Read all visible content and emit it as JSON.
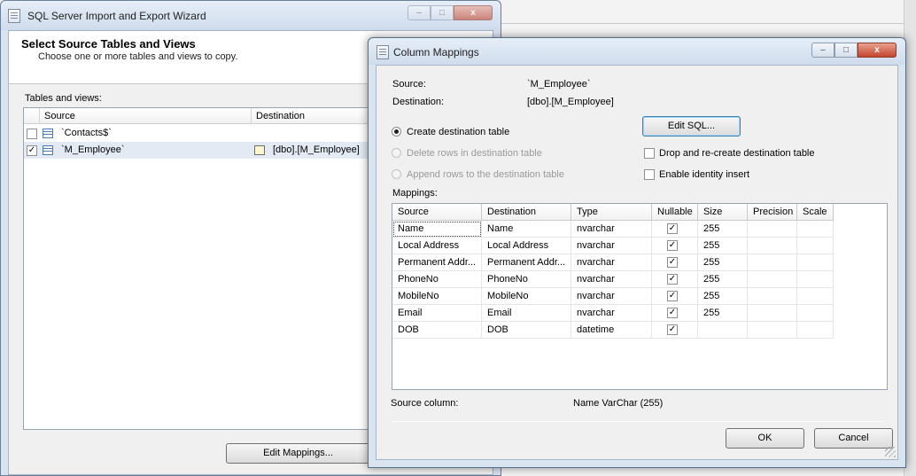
{
  "wizard": {
    "title": "SQL Server Import and Export Wizard",
    "heading": "Select Source Tables and Views",
    "subheading": "Choose one or more tables and views to copy.",
    "tables_label": "Tables and views:",
    "columns": {
      "source": "Source",
      "destination": "Destination"
    },
    "rows": [
      {
        "source": "`Contacts$`",
        "destination": "",
        "checked": false,
        "selected": false
      },
      {
        "source": "`M_Employee`",
        "destination": "[dbo].[M_Employee]",
        "checked": true,
        "selected": true
      }
    ],
    "edit_mappings_label": "Edit Mappings...",
    "caption_buttons": {
      "minimize": "–",
      "maximize": "□",
      "close": "x"
    }
  },
  "dialog": {
    "title": "Column Mappings",
    "source_label": "Source:",
    "source_value": "`M_Employee`",
    "destination_label": "Destination:",
    "destination_value": "[dbo].[M_Employee]",
    "options": {
      "create": "Create destination table",
      "delete": "Delete rows in destination table",
      "append": "Append rows to the destination table",
      "selected": "create"
    },
    "edit_sql_label": "Edit SQL...",
    "drop_recreate_label": "Drop and re-create destination table",
    "drop_recreate_checked": false,
    "identity_insert_label": "Enable identity insert",
    "identity_insert_checked": false,
    "mappings_label": "Mappings:",
    "mapping_headers": [
      "Source",
      "Destination",
      "Type",
      "Nullable",
      "Size",
      "Precision",
      "Scale"
    ],
    "mapping_rows": [
      {
        "source": "Name",
        "destination": "Name",
        "type": "nvarchar",
        "nullable": true,
        "size": "255",
        "precision": "",
        "scale": ""
      },
      {
        "source": "Local Address",
        "destination": "Local Address",
        "type": "nvarchar",
        "nullable": true,
        "size": "255",
        "precision": "",
        "scale": ""
      },
      {
        "source": "Permanent Addr...",
        "destination": "Permanent Addr...",
        "type": "nvarchar",
        "nullable": true,
        "size": "255",
        "precision": "",
        "scale": ""
      },
      {
        "source": "PhoneNo",
        "destination": "PhoneNo",
        "type": "nvarchar",
        "nullable": true,
        "size": "255",
        "precision": "",
        "scale": ""
      },
      {
        "source": "MobileNo",
        "destination": "MobileNo",
        "type": "nvarchar",
        "nullable": true,
        "size": "255",
        "precision": "",
        "scale": ""
      },
      {
        "source": "Email",
        "destination": "Email",
        "type": "nvarchar",
        "nullable": true,
        "size": "255",
        "precision": "",
        "scale": ""
      },
      {
        "source": "DOB",
        "destination": "DOB",
        "type": "datetime",
        "nullable": true,
        "size": "",
        "precision": "",
        "scale": ""
      }
    ],
    "source_column_label": "Source column:",
    "source_column_value": "Name VarChar (255)",
    "ok_label": "OK",
    "cancel_label": "Cancel",
    "caption_buttons": {
      "minimize": "–",
      "maximize": "□",
      "close": "x"
    }
  },
  "colors": {
    "window_frame": "#d9e4f1",
    "close_button": "#c4452c",
    "selection": "#e3eaf3",
    "default_button_border": "#3c7fb1"
  }
}
